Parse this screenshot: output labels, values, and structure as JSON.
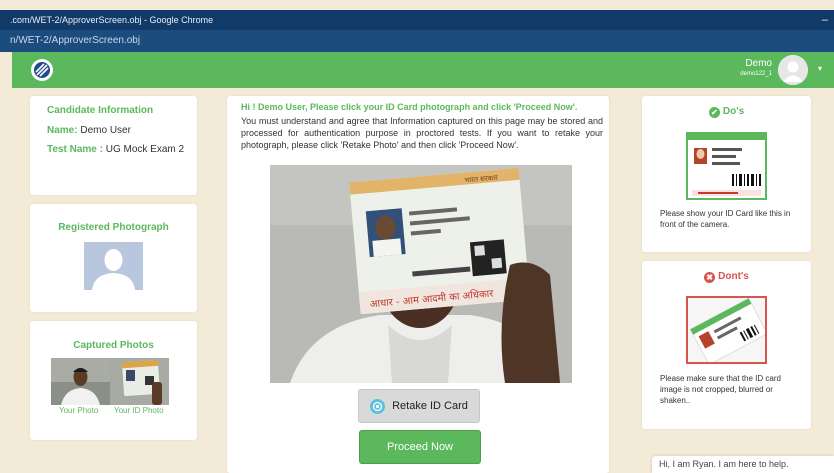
{
  "browser": {
    "title_bar": ".com/WET-2/ApproverScreen.obj - Google Chrome",
    "minimize_glyph": "–",
    "url": "n/WET-2/ApproverScreen.obj"
  },
  "header": {
    "logo_icon": "brand-logo-icon",
    "user_name": "Demo",
    "user_id": "demo122_1",
    "caret": "▾",
    "accent_color": "#5cb85c"
  },
  "candidate": {
    "heading": "Candidate Information",
    "name_label": "Name:",
    "name_value": "Demo User",
    "test_label": "Test Name :",
    "test_value": "UG Mock Exam 2"
  },
  "registered": {
    "heading": "Registered Photograph"
  },
  "captured": {
    "heading": "Captured Photos",
    "your_photo": "Your Photo",
    "your_id_photo": "Your ID Photo"
  },
  "main": {
    "instruction_title": "Hi ! Demo User, Please click your ID Card photograph and click 'Proceed Now'.",
    "instruction_text": "You must understand and agree that Information captured on this page may be stored and processed for authentication purpose in proctored tests. If you want to retake your photograph, please click 'Retake Photo' and then click 'Proceed Now'.",
    "retake_label": "Retake ID Card",
    "proceed_label": "Proceed Now"
  },
  "dos": {
    "icon_glyph": "✔",
    "heading": "Do's",
    "color": "#5cb85c",
    "text": "Please show your ID Card like this in front of the camera."
  },
  "donts": {
    "icon_glyph": "✖",
    "heading": "Dont's",
    "color": "#d9534f",
    "text": "Please make sure that the ID card image is not cropped, blurred or shaken.."
  },
  "chat": {
    "message": "Hi, I am Ryan. I am here to help."
  }
}
